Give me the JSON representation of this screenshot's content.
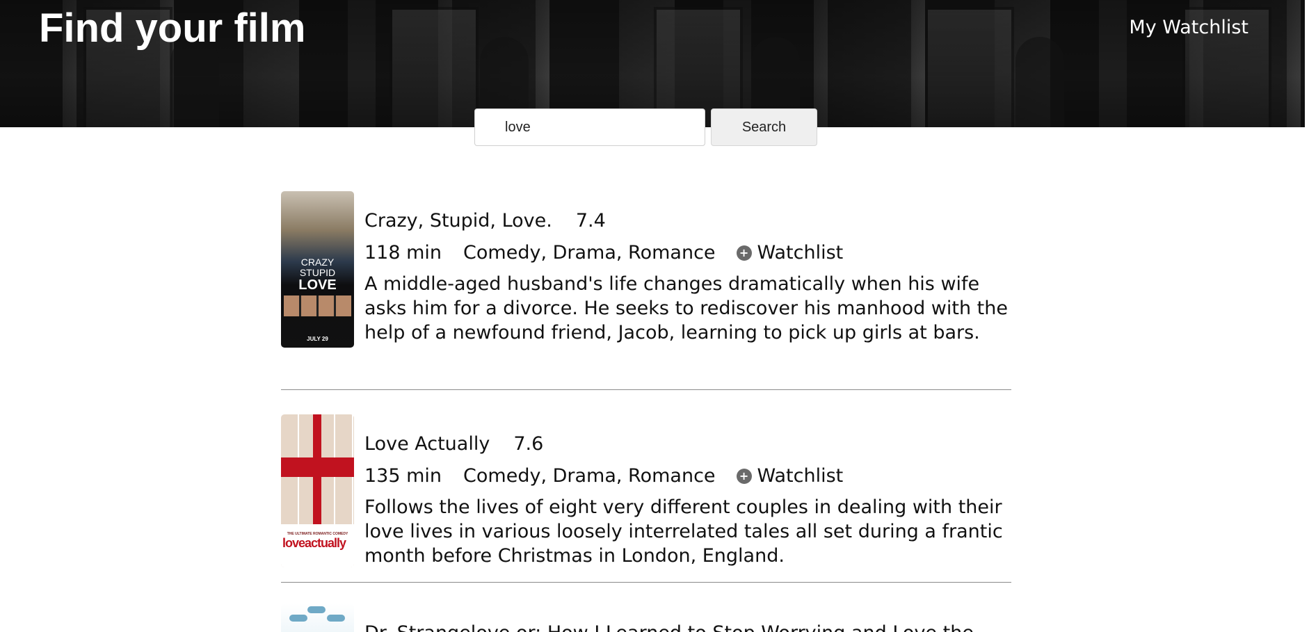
{
  "header": {
    "title": "Find your film",
    "watchlist_link": "My Watchlist"
  },
  "search": {
    "value": "love",
    "placeholder": "",
    "button_label": "Search"
  },
  "films": [
    {
      "title": "Crazy, Stupid, Love.",
      "rating": "7.4",
      "runtime": "118 min",
      "genres": "Comedy, Drama, Romance",
      "watchlist_label": "Watchlist",
      "plot": "A middle-aged husband's life changes dramatically when his wife asks him for a divorce. He seeks to rediscover his manhood with the help of a newfound friend, Jacob, learning to pick up girls at bars.",
      "poster_text": [
        "CRAZY",
        "STUPID",
        "LOVE",
        "JULY 29"
      ]
    },
    {
      "title": "Love Actually",
      "rating": "7.6",
      "runtime": "135 min",
      "genres": "Comedy, Drama, Romance",
      "watchlist_label": "Watchlist",
      "plot": "Follows the lives of eight very different couples in dealing with their love lives in various loosely interrelated tales all set during a frantic month before Christmas in London, England.",
      "poster_text": [
        "THE ULTIMATE ROMANTIC COMEDY",
        "loveactually"
      ]
    },
    {
      "title": "Dr. Strangelove or: How I Learned to Stop Worrying and Love the"
    }
  ],
  "icons": {
    "watchlist_add": "plus-circle-icon"
  },
  "colors": {
    "hero_dark": "#262626",
    "divider": "#8a8a8a",
    "plus_icon": "#6a6a6a",
    "button_bg": "#efefef"
  }
}
